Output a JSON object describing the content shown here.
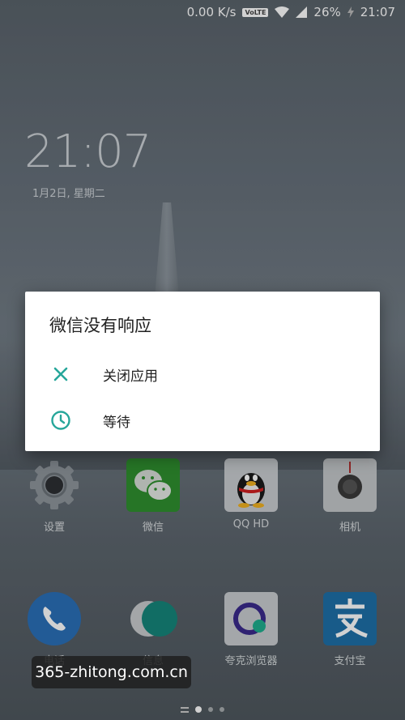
{
  "status_bar": {
    "net_speed": "0.00 K/s",
    "volte": "VoLTE",
    "battery": "26%",
    "time": "21:07"
  },
  "lock": {
    "clock": "21:07",
    "date": "1月2日, 星期二"
  },
  "dialog": {
    "title": "微信没有响应",
    "options": [
      {
        "label": "关闭应用",
        "icon": "close-icon"
      },
      {
        "label": "等待",
        "icon": "clock-icon"
      }
    ],
    "accent_color": "#26a69a"
  },
  "apps": [
    {
      "name": "设置",
      "icon": "settings-gear-icon"
    },
    {
      "name": "微信",
      "icon": "wechat-icon"
    },
    {
      "name": "QQ HD",
      "icon": "qq-penguin-icon"
    },
    {
      "name": "相机",
      "icon": "camera-icon"
    },
    {
      "name": "电话",
      "icon": "phone-icon"
    },
    {
      "name": "信息",
      "icon": "messages-icon"
    },
    {
      "name": "夸克浏览器",
      "icon": "quark-browser-icon"
    },
    {
      "name": "支付宝",
      "icon": "alipay-icon"
    }
  ],
  "watermark": "365-zhitong.com.cn"
}
